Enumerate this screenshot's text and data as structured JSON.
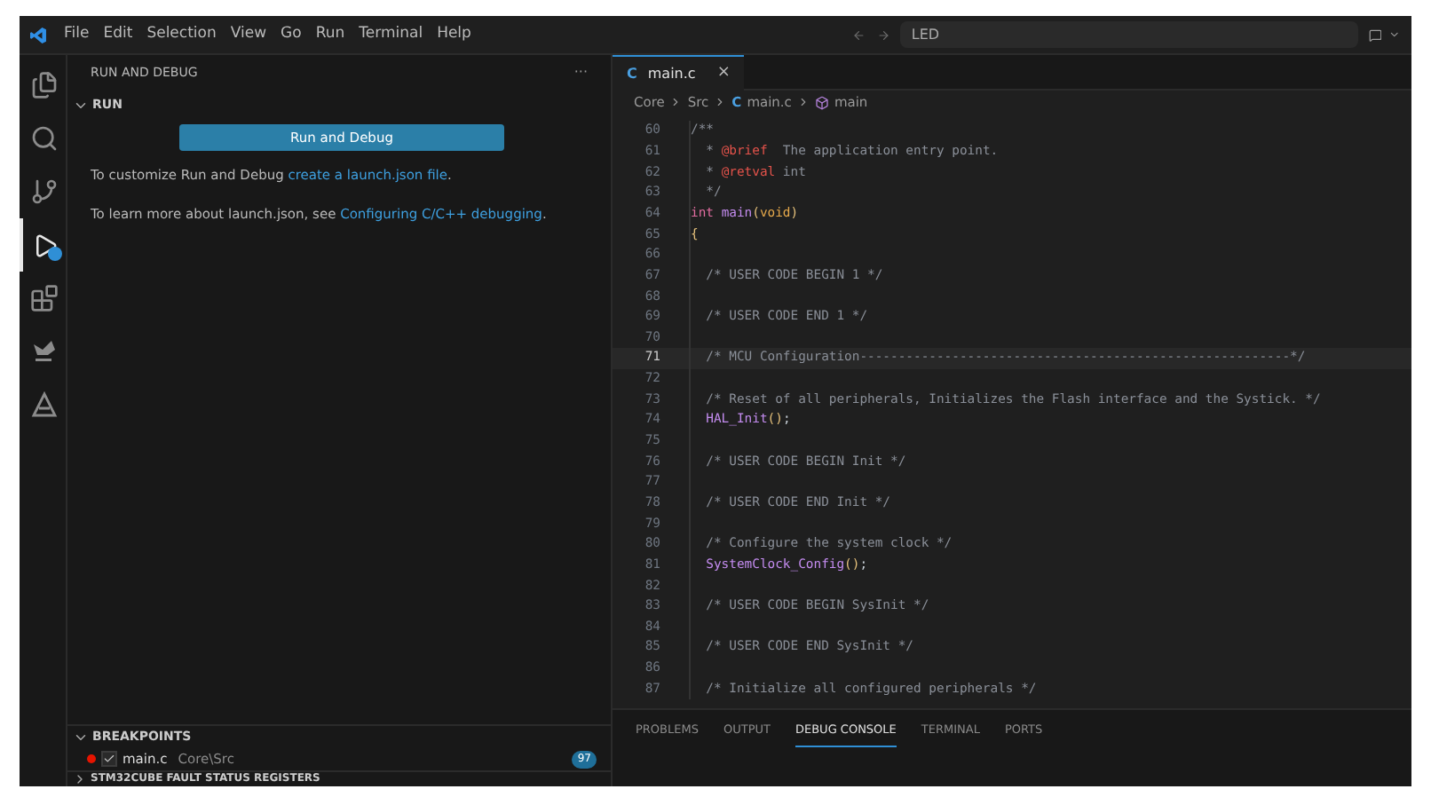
{
  "menu": [
    "File",
    "Edit",
    "Selection",
    "View",
    "Go",
    "Run",
    "Terminal",
    "Help"
  ],
  "command_center": {
    "value": "LED"
  },
  "activity_bar": [
    {
      "kind": "files",
      "selected": false
    },
    {
      "kind": "search",
      "selected": false
    },
    {
      "kind": "source-control",
      "selected": false
    },
    {
      "kind": "run-debug",
      "selected": true
    },
    {
      "kind": "extensions",
      "selected": false
    },
    {
      "kind": "stm",
      "selected": false
    },
    {
      "kind": "triangle",
      "selected": false
    }
  ],
  "sidebar": {
    "title": "RUN AND DEBUG",
    "more": "···",
    "section": "RUN",
    "button": "Run and Debug",
    "para1": {
      "text": "To customize Run and Debug ",
      "link": "create a launch.json file",
      "end": "."
    },
    "para2": {
      "text": "To learn more about launch.json, see ",
      "link": "Configuring C/C++ debugging",
      "end": "."
    },
    "breakpoints": {
      "title": "BREAKPOINTS",
      "items": [
        {
          "file": "main.c",
          "path": "Core\\Src",
          "line": "97",
          "checked": true
        }
      ]
    },
    "next_section": "STM32CUBE FAULT STATUS REGISTERS"
  },
  "editor": {
    "tab": {
      "icon": "C",
      "label": "main.c",
      "close": "×"
    },
    "breadcrumbs": [
      {
        "kind": "folder",
        "label": "Core"
      },
      {
        "kind": "folder",
        "label": "Src"
      },
      {
        "kind": "c-file",
        "icon": "C",
        "label": "main.c"
      },
      {
        "kind": "function",
        "label": "main"
      }
    ],
    "lines": [
      {
        "number": "60",
        "current": false,
        "tokens": [
          {
            "kind": "comment",
            "text": "/**"
          }
        ]
      },
      {
        "number": "61",
        "current": false,
        "tokens": [
          {
            "kind": "comment",
            "text": "  * "
          },
          {
            "kind": "tag",
            "text": "@brief"
          },
          {
            "kind": "comment",
            "text": "  The application entry point."
          }
        ]
      },
      {
        "number": "62",
        "current": false,
        "tokens": [
          {
            "kind": "comment",
            "text": "  * "
          },
          {
            "kind": "tag",
            "text": "@retval"
          },
          {
            "kind": "comment",
            "text": " int"
          }
        ]
      },
      {
        "number": "63",
        "current": false,
        "tokens": [
          {
            "kind": "comment",
            "text": "  */"
          }
        ]
      },
      {
        "number": "64",
        "current": false,
        "tokens": [
          {
            "kind": "keyword",
            "text": "int "
          },
          {
            "kind": "function",
            "text": "main"
          },
          {
            "kind": "paren",
            "text": "("
          },
          {
            "kind": "type",
            "text": "void"
          },
          {
            "kind": "paren",
            "text": ")"
          }
        ]
      },
      {
        "number": "65",
        "current": false,
        "tokens": [
          {
            "kind": "paren",
            "text": "{"
          }
        ]
      },
      {
        "number": "66",
        "current": false
      },
      {
        "number": "67",
        "current": false,
        "tokens": [
          {
            "kind": "comment",
            "text": "  /* USER CODE BEGIN 1 */"
          }
        ]
      },
      {
        "number": "68",
        "current": false
      },
      {
        "number": "69",
        "current": false,
        "tokens": [
          {
            "kind": "comment",
            "text": "  /* USER CODE END 1 */"
          }
        ]
      },
      {
        "number": "70",
        "current": false
      },
      {
        "number": "71",
        "current": true,
        "tokens": [
          {
            "kind": "comment",
            "text": "  /* MCU Configuration--------------------------------------------------------*/"
          }
        ]
      },
      {
        "number": "72",
        "current": false
      },
      {
        "number": "73",
        "current": false,
        "tokens": [
          {
            "kind": "comment",
            "text": "  /* Reset of all peripherals, Initializes the Flash interface and the Systick. */"
          }
        ]
      },
      {
        "number": "74",
        "current": false,
        "tokens": [
          {
            "kind": "function",
            "text": "  HAL_Init"
          },
          {
            "kind": "paren",
            "text": "()"
          },
          {
            "kind": "plain",
            "text": ";"
          }
        ]
      },
      {
        "number": "75",
        "current": false
      },
      {
        "number": "76",
        "current": false,
        "tokens": [
          {
            "kind": "comment",
            "text": "  /* USER CODE BEGIN Init */"
          }
        ]
      },
      {
        "number": "77",
        "current": false
      },
      {
        "number": "78",
        "current": false,
        "tokens": [
          {
            "kind": "comment",
            "text": "  /* USER CODE END Init */"
          }
        ]
      },
      {
        "number": "79",
        "current": false
      },
      {
        "number": "80",
        "current": false,
        "tokens": [
          {
            "kind": "comment",
            "text": "  /* Configure the system clock */"
          }
        ]
      },
      {
        "number": "81",
        "current": false,
        "tokens": [
          {
            "kind": "function",
            "text": "  SystemClock_Config"
          },
          {
            "kind": "paren",
            "text": "()"
          },
          {
            "kind": "plain",
            "text": ";"
          }
        ]
      },
      {
        "number": "82",
        "current": false
      },
      {
        "number": "83",
        "current": false,
        "tokens": [
          {
            "kind": "comment",
            "text": "  /* USER CODE BEGIN SysInit */"
          }
        ]
      },
      {
        "number": "84",
        "current": false
      },
      {
        "number": "85",
        "current": false,
        "tokens": [
          {
            "kind": "comment",
            "text": "  /* USER CODE END SysInit */"
          }
        ]
      },
      {
        "number": "86",
        "current": false
      },
      {
        "number": "87",
        "current": false,
        "tokens": [
          {
            "kind": "comment",
            "text": "  /* Initialize all configured peripherals */"
          }
        ]
      }
    ]
  },
  "panel": {
    "tabs": [
      {
        "label": "PROBLEMS",
        "selected": false
      },
      {
        "label": "OUTPUT",
        "selected": false
      },
      {
        "label": "DEBUG CONSOLE",
        "selected": true
      },
      {
        "label": "TERMINAL",
        "selected": false
      },
      {
        "label": "PORTS",
        "selected": false
      }
    ]
  }
}
